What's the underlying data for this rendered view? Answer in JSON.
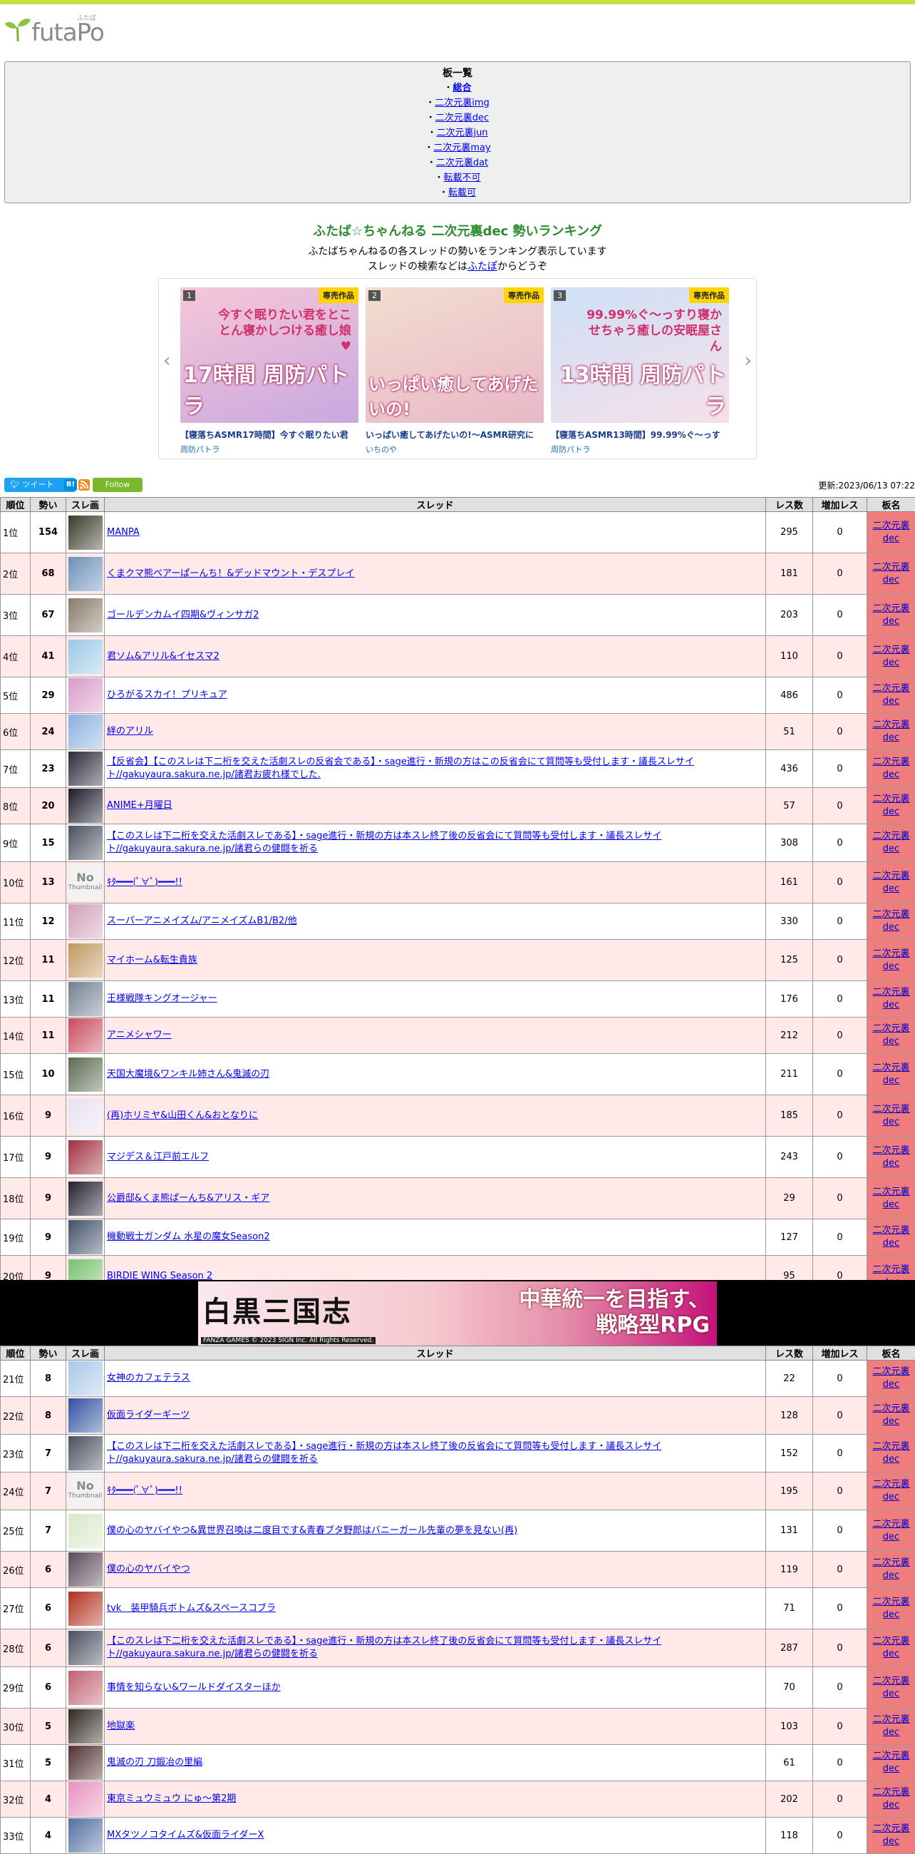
{
  "site": {
    "logo_text": "futaPo",
    "logo_kana": "ふたぽ"
  },
  "boards": {
    "title": "板一覧",
    "items": [
      {
        "prefix": "・",
        "label": "総合",
        "active": true
      },
      {
        "prefix": "・",
        "label": "二次元裏img"
      },
      {
        "prefix": "・",
        "label": "二次元裏dec"
      },
      {
        "prefix": "・",
        "label": "二次元裏jun"
      },
      {
        "prefix": "・",
        "label": "二次元裏may"
      },
      {
        "prefix": "・",
        "label": "二次元裏dat"
      },
      {
        "prefix": "・",
        "label": "転載不可"
      },
      {
        "prefix": "・",
        "label": "転載可"
      }
    ]
  },
  "heading": {
    "title": "ふたば☆ちゃんねる 二次元裏dec 勢いランキング",
    "desc1": "ふたばちゃんねるの各スレッドの勢いをランキング表示しています",
    "desc2_before": "スレッドの検索などは",
    "desc2_link": "ふたぽ",
    "desc2_after": "からどうぞ"
  },
  "carousel": {
    "badge": "専売作品",
    "items": [
      {
        "rank": "1",
        "title": "【寝落ちASMR17時間】今すぐ眠りたい君",
        "maker": "周防パトラ",
        "cover_big": "17時間",
        "cover_sub": "周防パトラ",
        "cover_top": "今すぐ眠りたい君をとことん寝かしつける癒し娘♥"
      },
      {
        "rank": "2",
        "title": "いっぱい癒してあげたいの!～ASMR研究に",
        "maker": "いちのや",
        "cover_big": "いっぱい癒してあげたいの!",
        "cover_sub": "",
        "cover_top": ""
      },
      {
        "rank": "3",
        "title": "【寝落ちASMR13時間】99.99%ぐ～っす",
        "maker": "周防パトラ",
        "cover_big": "13時間",
        "cover_sub": "周防パトラ",
        "cover_top": "99.99%ぐ～っすり寝かせちゃう癒しの安眠屋さん"
      }
    ]
  },
  "social": {
    "tweet": "ツイート",
    "hatena": "B!",
    "follow": "Follow"
  },
  "updated": "更新:2023/06/13 07:22",
  "table": {
    "headers": [
      "順位",
      "勢い",
      "スレ画",
      "スレッド",
      "レス数",
      "増加レス",
      "板名"
    ],
    "board_name": "二次元裏dec",
    "rows": [
      {
        "rank": "1位",
        "mom": "154",
        "title": "MANPA",
        "res": "295",
        "inc": "0",
        "color": "#3a3a2a"
      },
      {
        "rank": "2位",
        "mom": "68",
        "title": "くまクマ熊ベアーぱーんち！&デッドマウント・デスプレイ",
        "res": "181",
        "inc": "0",
        "color": "#6a8fb8"
      },
      {
        "rank": "3位",
        "mom": "67",
        "title": "ゴールデンカムイ四期&ヴィンサガ2",
        "res": "203",
        "inc": "0",
        "color": "#8a7a6a"
      },
      {
        "rank": "4位",
        "mom": "41",
        "title": "君ソム&アリル&イセスマ2",
        "res": "110",
        "inc": "0",
        "color": "#9cc8e8"
      },
      {
        "rank": "5位",
        "mom": "29",
        "title": "ひろがるスカイ！プリキュア",
        "res": "486",
        "inc": "0",
        "color": "#d99ac8"
      },
      {
        "rank": "6位",
        "mom": "24",
        "title": "絆のアリル",
        "res": "51",
        "inc": "0",
        "color": "#8ab0e0"
      },
      {
        "rank": "7位",
        "mom": "23",
        "title": "【反省会】【このスレは下二桁を交えた活劇スレの反省会である】・sage進行・新規の方はこの反省会にて質問等も受付します・議長スレサイト//gakuyaura.sakura.ne.jp/諸君お疲れ様でした.",
        "res": "436",
        "inc": "0",
        "color": "#2a2a3a"
      },
      {
        "rank": "8位",
        "mom": "20",
        "title": "ANIME+月曜日",
        "res": "57",
        "inc": "0",
        "color": "#1a1a2a"
      },
      {
        "rank": "9位",
        "mom": "15",
        "title": "【このスレは下二桁を交えた活劇スレである】・sage進行・新規の方は本スレ終了後の反省会にて質問等も受付します・議長スレサイト//gakuyaura.sakura.ne.jp/諸君らの健闘を祈る",
        "res": "308",
        "inc": "0",
        "color": "#4a5060"
      },
      {
        "rank": "10位",
        "mom": "13",
        "title": "ｷﾀ━━━(ﾟ∀ﾟ)━━━!!",
        "res": "161",
        "inc": "0",
        "nothumb": true
      },
      {
        "rank": "11位",
        "mom": "12",
        "title": "スーパーアニメイズム/アニメイズムB1/B2/他",
        "res": "330",
        "inc": "0",
        "color": "#d0a0b8"
      },
      {
        "rank": "12位",
        "mom": "11",
        "title": "マイホーム&転生貴族",
        "res": "125",
        "inc": "0",
        "color": "#c09a60"
      },
      {
        "rank": "13位",
        "mom": "11",
        "title": "王様戦隊キングオージャー",
        "res": "176",
        "inc": "0",
        "color": "#708090"
      },
      {
        "rank": "14位",
        "mom": "11",
        "title": "アニメシャワー",
        "res": "212",
        "inc": "0",
        "color": "#c84a5a"
      },
      {
        "rank": "15位",
        "mom": "10",
        "title": "天国大魔境&ワンキル姉さん&鬼滅の刃",
        "res": "211",
        "inc": "0",
        "color": "#5a6a50"
      },
      {
        "rank": "16位",
        "mom": "9",
        "title": "(再)ホリミヤ&山田くん&おとなりに",
        "res": "185",
        "inc": "0",
        "color": "#e8e0f0"
      },
      {
        "rank": "17位",
        "mom": "9",
        "title": "マジデス＆江戸前エルフ",
        "res": "243",
        "inc": "0",
        "color": "#a03040"
      },
      {
        "rank": "18位",
        "mom": "9",
        "title": "公爵邸&くま熊ぱーんち&アリス・ギア",
        "res": "29",
        "inc": "0",
        "color": "#202030"
      },
      {
        "rank": "19位",
        "mom": "9",
        "title": "機動戦士ガンダム 水星の魔女Season2",
        "res": "127",
        "inc": "0",
        "color": "#405068"
      },
      {
        "rank": "20位",
        "mom": "9",
        "title": "BIRDIE WING Season 2",
        "res": "95",
        "inc": "0",
        "color": "#7ac070"
      },
      {
        "rank": "21位",
        "mom": "8",
        "title": "女神のカフェテラス",
        "res": "22",
        "inc": "0",
        "color": "#a8c8e8"
      },
      {
        "rank": "22位",
        "mom": "8",
        "title": "仮面ライダーギーツ",
        "res": "128",
        "inc": "0",
        "color": "#3050a0"
      },
      {
        "rank": "23位",
        "mom": "7",
        "title": "【このスレは下二桁を交えた活劇スレである】・sage進行・新規の方は本スレ終了後の反省会にて質問等も受付します・議長スレサイト//gakuyaura.sakura.ne.jp/諸君らの健闘を祈る",
        "res": "152",
        "inc": "0",
        "color": "#4a5060"
      },
      {
        "rank": "24位",
        "mom": "7",
        "title": "ｷﾀ━━━(ﾟ∀ﾟ)━━━!!",
        "res": "195",
        "inc": "0",
        "nothumb": true
      },
      {
        "rank": "25位",
        "mom": "7",
        "title": "僕の心のヤバイやつ&異世界召喚は二度目です&青春ブタ野郎はバニーガール先輩の夢を見ない(再)",
        "res": "131",
        "inc": "0",
        "color": "#d8e8c8"
      },
      {
        "rank": "26位",
        "mom": "6",
        "title": "僕の心のヤバイやつ",
        "res": "119",
        "inc": "0",
        "color": "#5a4a5a"
      },
      {
        "rank": "27位",
        "mom": "6",
        "title": "tvk　装甲騎兵ボトムズ&スペースコブラ",
        "res": "71",
        "inc": "0",
        "color": "#b03020"
      },
      {
        "rank": "28位",
        "mom": "6",
        "title": "【このスレは下二桁を交えた活劇スレである】・sage進行・新規の方は本スレ終了後の反省会にて質問等も受付します・議長スレサイト//gakuyaura.sakura.ne.jp/諸君らの健闘を祈る",
        "res": "287",
        "inc": "0",
        "color": "#4a5060"
      },
      {
        "rank": "29位",
        "mom": "6",
        "title": "事情を知らない&ワールドダイスターほか",
        "res": "70",
        "inc": "0",
        "color": "#c06070"
      },
      {
        "rank": "30位",
        "mom": "5",
        "title": "地獄楽",
        "res": "103",
        "inc": "0",
        "color": "#302820"
      },
      {
        "rank": "31位",
        "mom": "5",
        "title": "鬼滅の刃 刀鍛冶の里編",
        "res": "61",
        "inc": "0",
        "color": "#503030"
      },
      {
        "rank": "32位",
        "mom": "4",
        "title": "東京ミュウミュウ にゅ～第2期",
        "res": "202",
        "inc": "0",
        "color": "#e890c0"
      },
      {
        "rank": "33位",
        "mom": "4",
        "title": "MXタツノコタイムズ&仮面ライダーX",
        "res": "118",
        "inc": "0",
        "color": "#5070a0"
      }
    ]
  },
  "ad": {
    "left_text": "白黒三国志",
    "right_line1": "中華統一を目指す、",
    "right_line2": "戦略型RPG",
    "copyright": "FANZA GAMES  © 2023 SIGN Inc. All Rights Reserved."
  },
  "colors": {
    "accent": "#c5e13f",
    "title_green": "#2e8b2e",
    "row_pink": "#ffe9e9",
    "board_cell": "#f07d7d",
    "link": "#0000ee"
  }
}
